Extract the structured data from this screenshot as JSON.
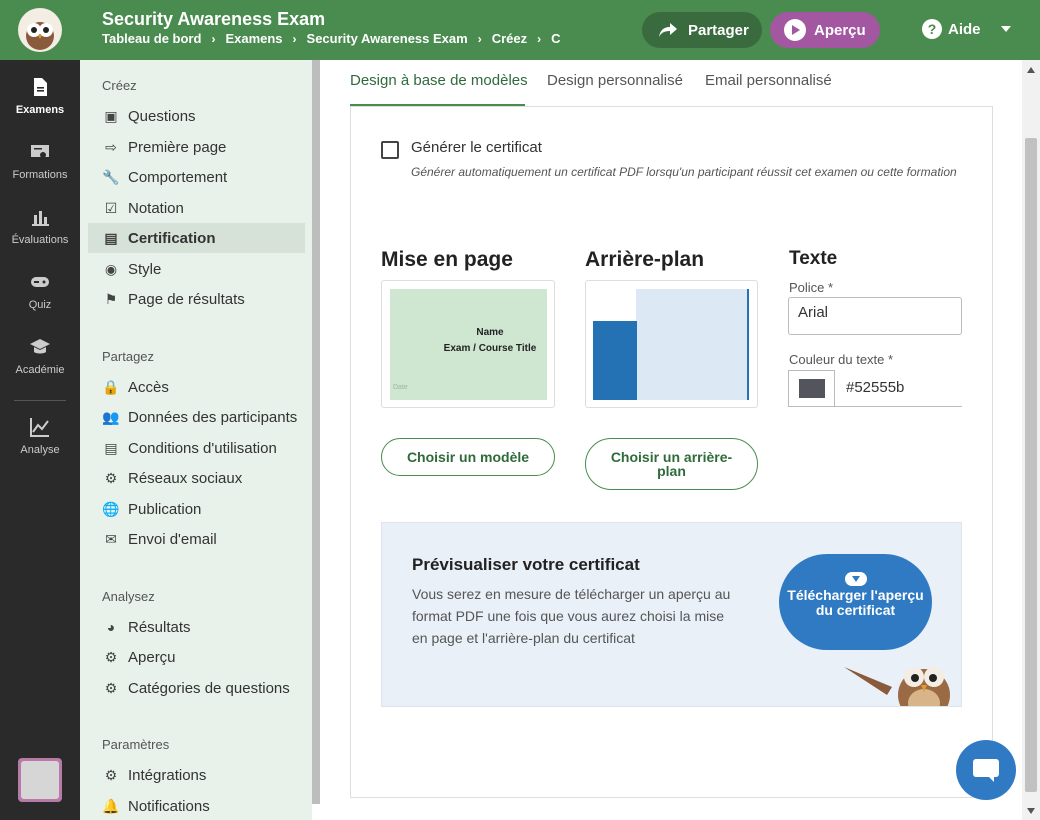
{
  "header": {
    "title": "Security Awareness Exam",
    "breadcrumb": [
      "Tableau de bord",
      "Examens",
      "Security Awareness Exam",
      "Créez",
      "C"
    ],
    "share_label": "Partager",
    "preview_label": "Aperçu",
    "help_label": "Aide"
  },
  "rail": {
    "items": [
      {
        "label": "Examens",
        "icon": "document-icon"
      },
      {
        "label": "Formations",
        "icon": "certificate-icon"
      },
      {
        "label": "Évaluations",
        "icon": "bar-chart-icon"
      },
      {
        "label": "Quiz",
        "icon": "gamepad-icon"
      },
      {
        "label": "Académie",
        "icon": "graduation-cap-icon"
      },
      {
        "label": "Analyse",
        "icon": "line-chart-icon"
      }
    ],
    "active": "Examens"
  },
  "sidebar": {
    "sections": [
      {
        "title": "Créez",
        "items": [
          {
            "label": "Questions",
            "icon": "question-icon"
          },
          {
            "label": "Première page",
            "icon": "login-icon"
          },
          {
            "label": "Comportement",
            "icon": "wrench-icon"
          },
          {
            "label": "Notation",
            "icon": "clipboard-check-icon"
          },
          {
            "label": "Certification",
            "icon": "certificate-icon"
          },
          {
            "label": "Style",
            "icon": "palette-icon"
          },
          {
            "label": "Page de résultats",
            "icon": "flag-icon"
          }
        ]
      },
      {
        "title": "Partagez",
        "items": [
          {
            "label": "Accès",
            "icon": "lock-icon"
          },
          {
            "label": "Données des participants",
            "icon": "users-icon"
          },
          {
            "label": "Conditions d'utilisation",
            "icon": "document-icon"
          },
          {
            "label": "Réseaux sociaux",
            "icon": "gear-icon"
          },
          {
            "label": "Publication",
            "icon": "globe-icon"
          },
          {
            "label": "Envoi d'email",
            "icon": "mail-icon"
          }
        ]
      },
      {
        "title": "Analysez",
        "items": [
          {
            "label": "Résultats",
            "icon": "pie-chart-icon"
          },
          {
            "label": "Aperçu",
            "icon": "gear-icon"
          },
          {
            "label": "Catégories de questions",
            "icon": "gear-icon"
          }
        ]
      },
      {
        "title": "Paramètres",
        "items": [
          {
            "label": "Intégrations",
            "icon": "gear-icon"
          },
          {
            "label": "Notifications",
            "icon": "bell-icon"
          }
        ]
      }
    ],
    "active": "Certification"
  },
  "tabs": {
    "items": [
      "Design à base de modèles",
      "Design personnalisé",
      "Email personnalisé"
    ],
    "active": "Design à base de modèles"
  },
  "certificate": {
    "generate_label": "Générer le certificat",
    "generate_checked": false,
    "generate_help": "Générer automatiquement un certificat PDF lorsqu'un participant réussit cet examen ou cette formation"
  },
  "layout": {
    "heading": "Mise en page",
    "thumb_name": "Name",
    "thumb_title": "Exam / Course Title",
    "thumb_date": "Date",
    "button": "Choisir un modèle"
  },
  "background": {
    "heading": "Arrière-plan",
    "button": "Choisir un arrière-plan"
  },
  "text": {
    "heading": "Texte",
    "font_label": "Police *",
    "font_value": "Arial",
    "color_label": "Couleur du texte *",
    "color_value": "#52555b"
  },
  "preview_box": {
    "title": "Prévisualiser votre certificat",
    "description": "Vous serez en mesure de télécharger un aperçu au format PDF une fois que vous aurez choisi la mise en page et l'arrière-plan du certificat",
    "download_button": "Télécharger l'aperçu du certificat"
  },
  "colors": {
    "brand_green": "#4a8b50",
    "share_green": "#3a6b3f",
    "preview_purple": "#a357a1",
    "rail_dark": "#2a2a2a",
    "accent_blue": "#2f7ac2"
  }
}
